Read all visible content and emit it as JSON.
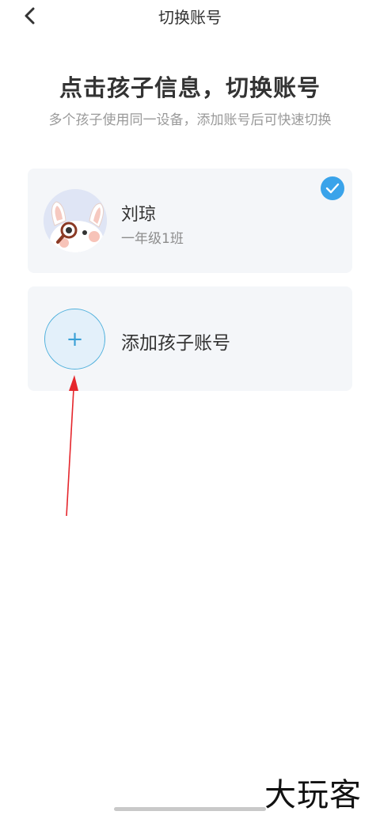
{
  "header": {
    "back_icon": "chevron-left-icon",
    "title": "切换账号"
  },
  "main": {
    "headline": "点击孩子信息，切换账号",
    "subline": "多个孩子使用同一设备，添加账号后可快速切换"
  },
  "accounts": [
    {
      "name": "刘琼",
      "class_name": "一年级1班",
      "avatar_icon": "bunny-avatar-icon",
      "selected": true,
      "check_icon": "check-icon"
    }
  ],
  "add_account": {
    "plus": "+",
    "label": "添加孩子账号"
  },
  "watermark": "大玩客",
  "colors": {
    "accent": "#3aa3ea",
    "card_bg": "#f4f6f9",
    "annotation": "#e5262c"
  }
}
